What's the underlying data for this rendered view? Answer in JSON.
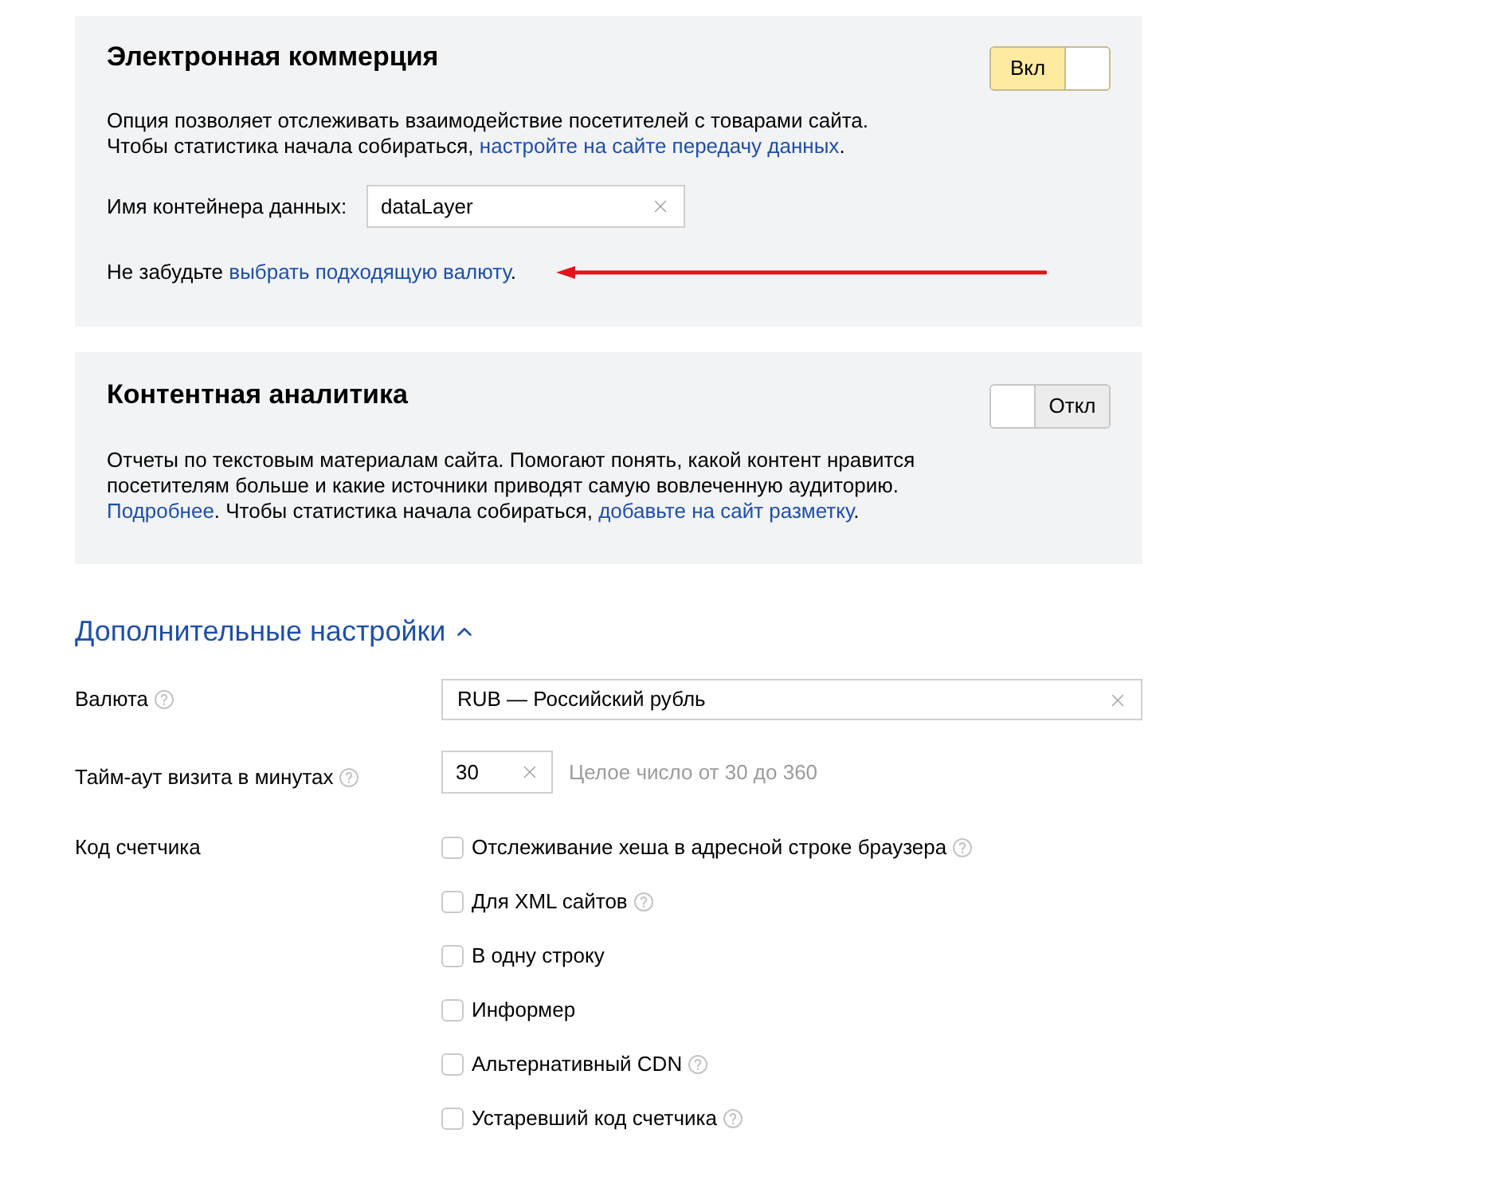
{
  "panels": [
    {
      "title": "Электронная коммерция",
      "toggle": {
        "label": "Вкл",
        "on": true
      },
      "description": [
        {
          "kind": "text",
          "text": "Опция позволяет отслеживать взаимодействие посетителей с товарами сайта. Чтобы статистика начала собираться, "
        },
        {
          "kind": "link",
          "text": "настройте на сайте передачу данных"
        },
        {
          "kind": "text",
          "text": "."
        }
      ],
      "field": {
        "label": "Имя контейнера данных:",
        "value": "dataLayer"
      },
      "note": [
        {
          "kind": "text",
          "text": "Не забудьте "
        },
        {
          "kind": "link",
          "text": "выбрать подходящую валюту"
        },
        {
          "kind": "text",
          "text": "."
        }
      ]
    },
    {
      "title": "Контентная аналитика",
      "toggle": {
        "label": "Откл",
        "on": false
      },
      "description": [
        {
          "kind": "text",
          "text": "Отчеты по текстовым материалам сайта. Помогают понять, какой контент нравится посетителям больше и какие источники приводят самую вовлеченную аудиторию. "
        },
        {
          "kind": "link",
          "text": "Подробнее"
        },
        {
          "kind": "text",
          "text": ". Чтобы статистика начала собираться, "
        },
        {
          "kind": "link",
          "text": "добавьте на сайт разметку"
        },
        {
          "kind": "text",
          "text": "."
        }
      ]
    }
  ],
  "advanced": {
    "title": "Дополнительные настройки",
    "expanded": true,
    "rows": [
      {
        "kind": "select",
        "label": "Валюта",
        "help": true,
        "value": "RUB — Российский рубль"
      },
      {
        "kind": "number",
        "label": "Тайм-аут визита в минутах",
        "help": true,
        "value": "30",
        "hint": "Целое число от 30 до 360"
      },
      {
        "kind": "checkboxes",
        "label": "Код счетчика",
        "help": false,
        "options": [
          {
            "label": "Отслеживание хеша в адресной строке браузера",
            "checked": false,
            "help": true
          },
          {
            "label": "Для XML сайтов",
            "checked": false,
            "help": true
          },
          {
            "label": "В одну строку",
            "checked": false,
            "help": false
          },
          {
            "label": "Информер",
            "checked": false,
            "help": false
          },
          {
            "label": "Альтернативный CDN",
            "checked": false,
            "help": true
          },
          {
            "label": "Устаревший код счетчика",
            "checked": false,
            "help": true
          }
        ]
      }
    ]
  }
}
